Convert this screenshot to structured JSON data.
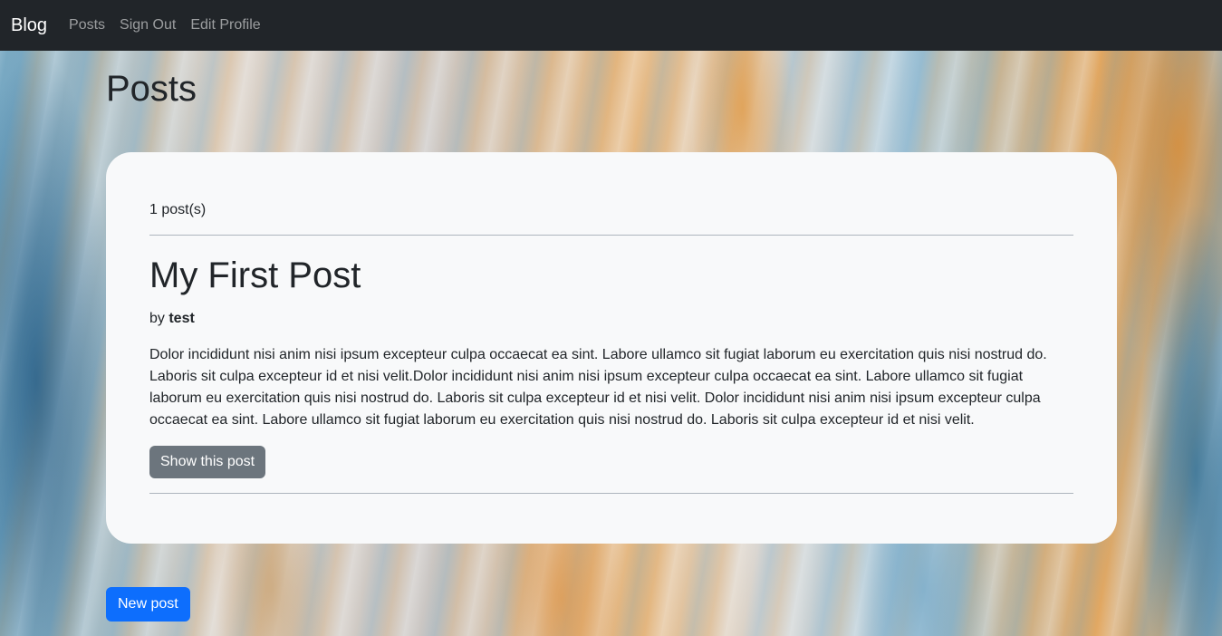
{
  "navbar": {
    "brand": "Blog",
    "links": [
      "Posts",
      "Sign Out",
      "Edit Profile"
    ]
  },
  "page": {
    "title": "Posts"
  },
  "posts_list": {
    "count_text": "1 post(s)",
    "posts": [
      {
        "title": "My First Post",
        "by_label": "by",
        "author": "test",
        "body": "Dolor incididunt nisi anim nisi ipsum excepteur culpa occaecat ea sint. Labore ullamco sit fugiat laborum eu exercitation quis nisi nostrud do. Laboris sit culpa excepteur id et nisi velit.Dolor incididunt nisi anim nisi ipsum excepteur culpa occaecat ea sint. Labore ullamco sit fugiat laborum eu exercitation quis nisi nostrud do. Laboris sit culpa excepteur id et nisi velit. Dolor incididunt nisi anim nisi ipsum excepteur culpa occaecat ea sint. Labore ullamco sit fugiat laborum eu exercitation quis nisi nostrud do. Laboris sit culpa excepteur id et nisi velit.",
        "show_label": "Show this post"
      }
    ]
  },
  "actions": {
    "new_post_label": "New post"
  },
  "colors": {
    "navbar_bg": "#212529",
    "card_bg": "#f8f9fa",
    "primary": "#0d6efd",
    "secondary": "#6c757d"
  }
}
